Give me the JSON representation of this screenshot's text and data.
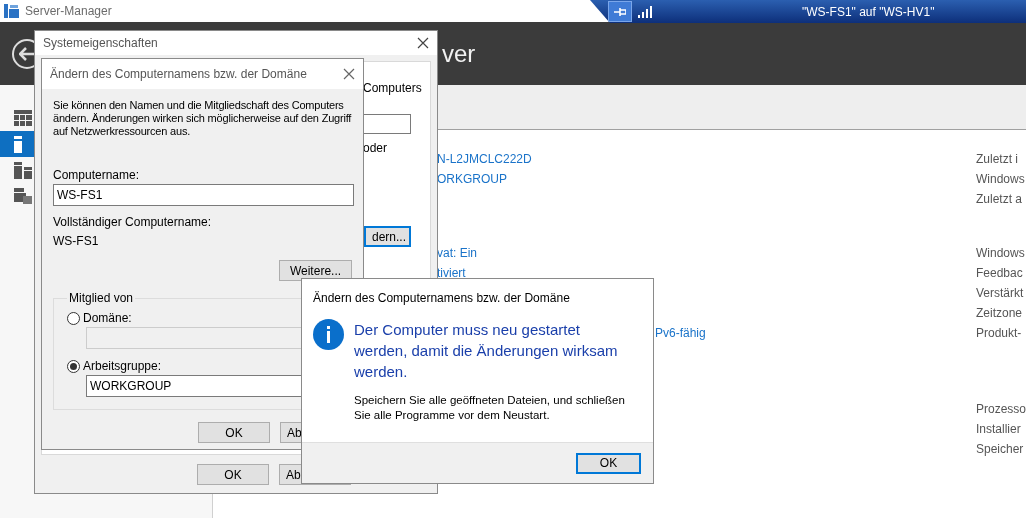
{
  "window": {
    "title": "Server-Manager"
  },
  "remote_bar": {
    "pinned": true,
    "title": "\"WS-FS1\" auf \"WS-HV1\""
  },
  "header": {
    "title": "ver"
  },
  "sidebar": {
    "items": [
      {
        "kind": "dashboard",
        "selected": false
      },
      {
        "kind": "local",
        "selected": true
      },
      {
        "kind": "servers",
        "selected": false
      },
      {
        "kind": "files",
        "selected": false
      }
    ]
  },
  "properties": {
    "groups": [
      {
        "rows": [
          {
            "value": "N-L2JMCLC222D",
            "label": "Zuletzt i"
          },
          {
            "value": "ORKGROUP",
            "label": "Windows"
          },
          {
            "label": "Zuletzt a"
          }
        ]
      },
      {
        "rows": [
          {
            "value": "vat: Ein",
            "label": "Windows"
          },
          {
            "value": "tiviert",
            "label": "Feedbac"
          },
          {
            "label": "Verstärkt"
          },
          {
            "label": "Zeitzone"
          },
          {
            "value": "Pv6-fähig",
            "label": "Produkt-"
          }
        ]
      },
      {
        "rows": [
          {
            "label": "Prozesso"
          },
          {
            "label": "Installier"
          },
          {
            "label": "Speicher"
          }
        ]
      }
    ]
  },
  "system_properties": {
    "title": "Systemeigenschaften",
    "description_end": "Computers",
    "option_text": "oder",
    "change_button": "dern...",
    "buttons": [
      "OK",
      "Ab"
    ]
  },
  "rename_dialog": {
    "title": "Ändern des Computernamens bzw. der Domäne",
    "description": "Sie können den Namen und die Mitgliedschaft des Computers ändern. Änderungen wirken sich möglicherweise auf den Zugriff auf Netzwerkressourcen aus.",
    "computer_name_label": "Computername:",
    "computer_name": "WS-FS1",
    "full_name_label": "Vollständiger Computername:",
    "full_name": "WS-FS1",
    "more_button": "Weitere...",
    "member_of": {
      "legend": "Mitglied von",
      "options": [
        {
          "label": "Domäne:",
          "selected": false
        },
        {
          "label": "Arbeitsgruppe:",
          "selected": true,
          "value": "WORKGROUP"
        }
      ]
    },
    "buttons": [
      "OK",
      "Ab"
    ]
  },
  "message_box": {
    "title": "Ändern des Computernamens bzw. der Domäne",
    "heading": "Der Computer muss neu gestartet werden, damit die Änderungen wirksam werden.",
    "text": "Speichern Sie alle geöffneten Dateien, und schließen Sie alle Programme vor dem Neustart.",
    "button": "OK"
  }
}
